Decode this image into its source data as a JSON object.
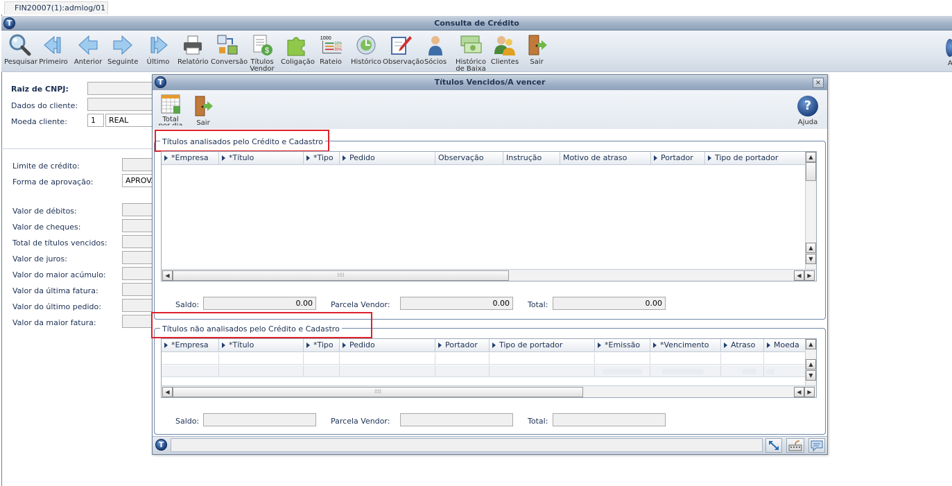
{
  "tab": {
    "label": "FIN20007(1):admlog/01"
  },
  "window": {
    "title": "Consulta de Crédito"
  },
  "toolbar": {
    "items": [
      {
        "label": "Pesquisar",
        "icon": "magnifier-icon"
      },
      {
        "label": "Primeiro",
        "icon": "first-arrow-icon"
      },
      {
        "label": "Anterior",
        "icon": "left-arrow-icon"
      },
      {
        "label": "Seguinte",
        "icon": "right-arrow-icon"
      },
      {
        "label": "Último",
        "icon": "last-arrow-icon"
      },
      {
        "label": "Relatório",
        "icon": "printer-icon"
      },
      {
        "label": "Conversão",
        "icon": "conversion-icon"
      },
      {
        "label": "Títulos",
        "label2": "Vendor",
        "icon": "titles-vendor-icon"
      },
      {
        "label": "Coligação",
        "icon": "puzzle-icon"
      },
      {
        "label": "Rateio",
        "icon": "rateio-icon",
        "badge": "1000",
        "pcts": [
          "10%",
          "20%",
          "30%"
        ]
      },
      {
        "label": "Histórico",
        "icon": "globe-history-icon"
      },
      {
        "label": "Observação",
        "icon": "note-pencil-icon"
      },
      {
        "label": "Sócios",
        "icon": "partner-person-icon"
      },
      {
        "label": "Histórico",
        "label2": "de Baixa",
        "icon": "money-history-icon"
      },
      {
        "label": "Clientes",
        "icon": "clients-icon"
      },
      {
        "label": "Sair",
        "icon": "exit-door-icon"
      }
    ],
    "right_edge_label": "A"
  },
  "form": {
    "raiz_cnpj_label": "Raiz de CNPJ:",
    "dados_cliente_label": "Dados do cliente:",
    "moeda_cliente_label": "Moeda cliente:",
    "moeda_code": "1",
    "moeda_name": "REAL",
    "limite_label": "Limite de crédito:",
    "forma_aprov_label": "Forma de aprovação:",
    "forma_aprov_value": "APROVA",
    "valor_debitos_label": "Valor de débitos:",
    "valor_cheques_label": "Valor de cheques:",
    "total_vencidos_label": "Total de títulos vencidos:",
    "valor_juros_label": "Valor de juros:",
    "maior_acumulo_label": "Valor do maior acúmulo:",
    "ultima_fatura_label": "Valor da última fatura:",
    "ultimo_pedido_label": "Valor do último pedido:",
    "maior_fatura_label": "Valor da maior fatura:"
  },
  "modal": {
    "title": "Títulos Vencidos/A vencer",
    "close": "×",
    "toolbar": {
      "total_label": "Total",
      "total_label2": "por dia",
      "sair_label": "Sair",
      "ajuda_label": "Ajuda"
    },
    "group1": {
      "legend": "Títulos analisados pelo Crédito e Cadastro",
      "columns": [
        "*Empresa",
        "*Título",
        "*Tipo",
        "Pedido",
        "Observação",
        "Instrução",
        "Motivo de atraso",
        "Portador",
        "Tipo de portador"
      ],
      "saldo_label": "Saldo:",
      "saldo_value": "0.00",
      "parcela_label": "Parcela Vendor:",
      "parcela_value": "0.00",
      "total_label": "Total:",
      "total_value": "0.00"
    },
    "group2": {
      "legend": "Títulos não analisados pelo Crédito e Cadastro",
      "columns": [
        "*Empresa",
        "*Título",
        "*Tipo",
        "Pedido",
        "Portador",
        "Tipo de portador",
        "*Emissão",
        "*Vencimento",
        "Atraso",
        "Moeda"
      ],
      "saldo_label": "Saldo:",
      "parcela_label": "Parcela Vendor:",
      "total_label": "Total:"
    }
  },
  "colors": {
    "title_bar": "#9fb0c6",
    "highlight_red": "#e0202a",
    "group_border": "#6d86a6",
    "label_text": "#1b2f52"
  }
}
